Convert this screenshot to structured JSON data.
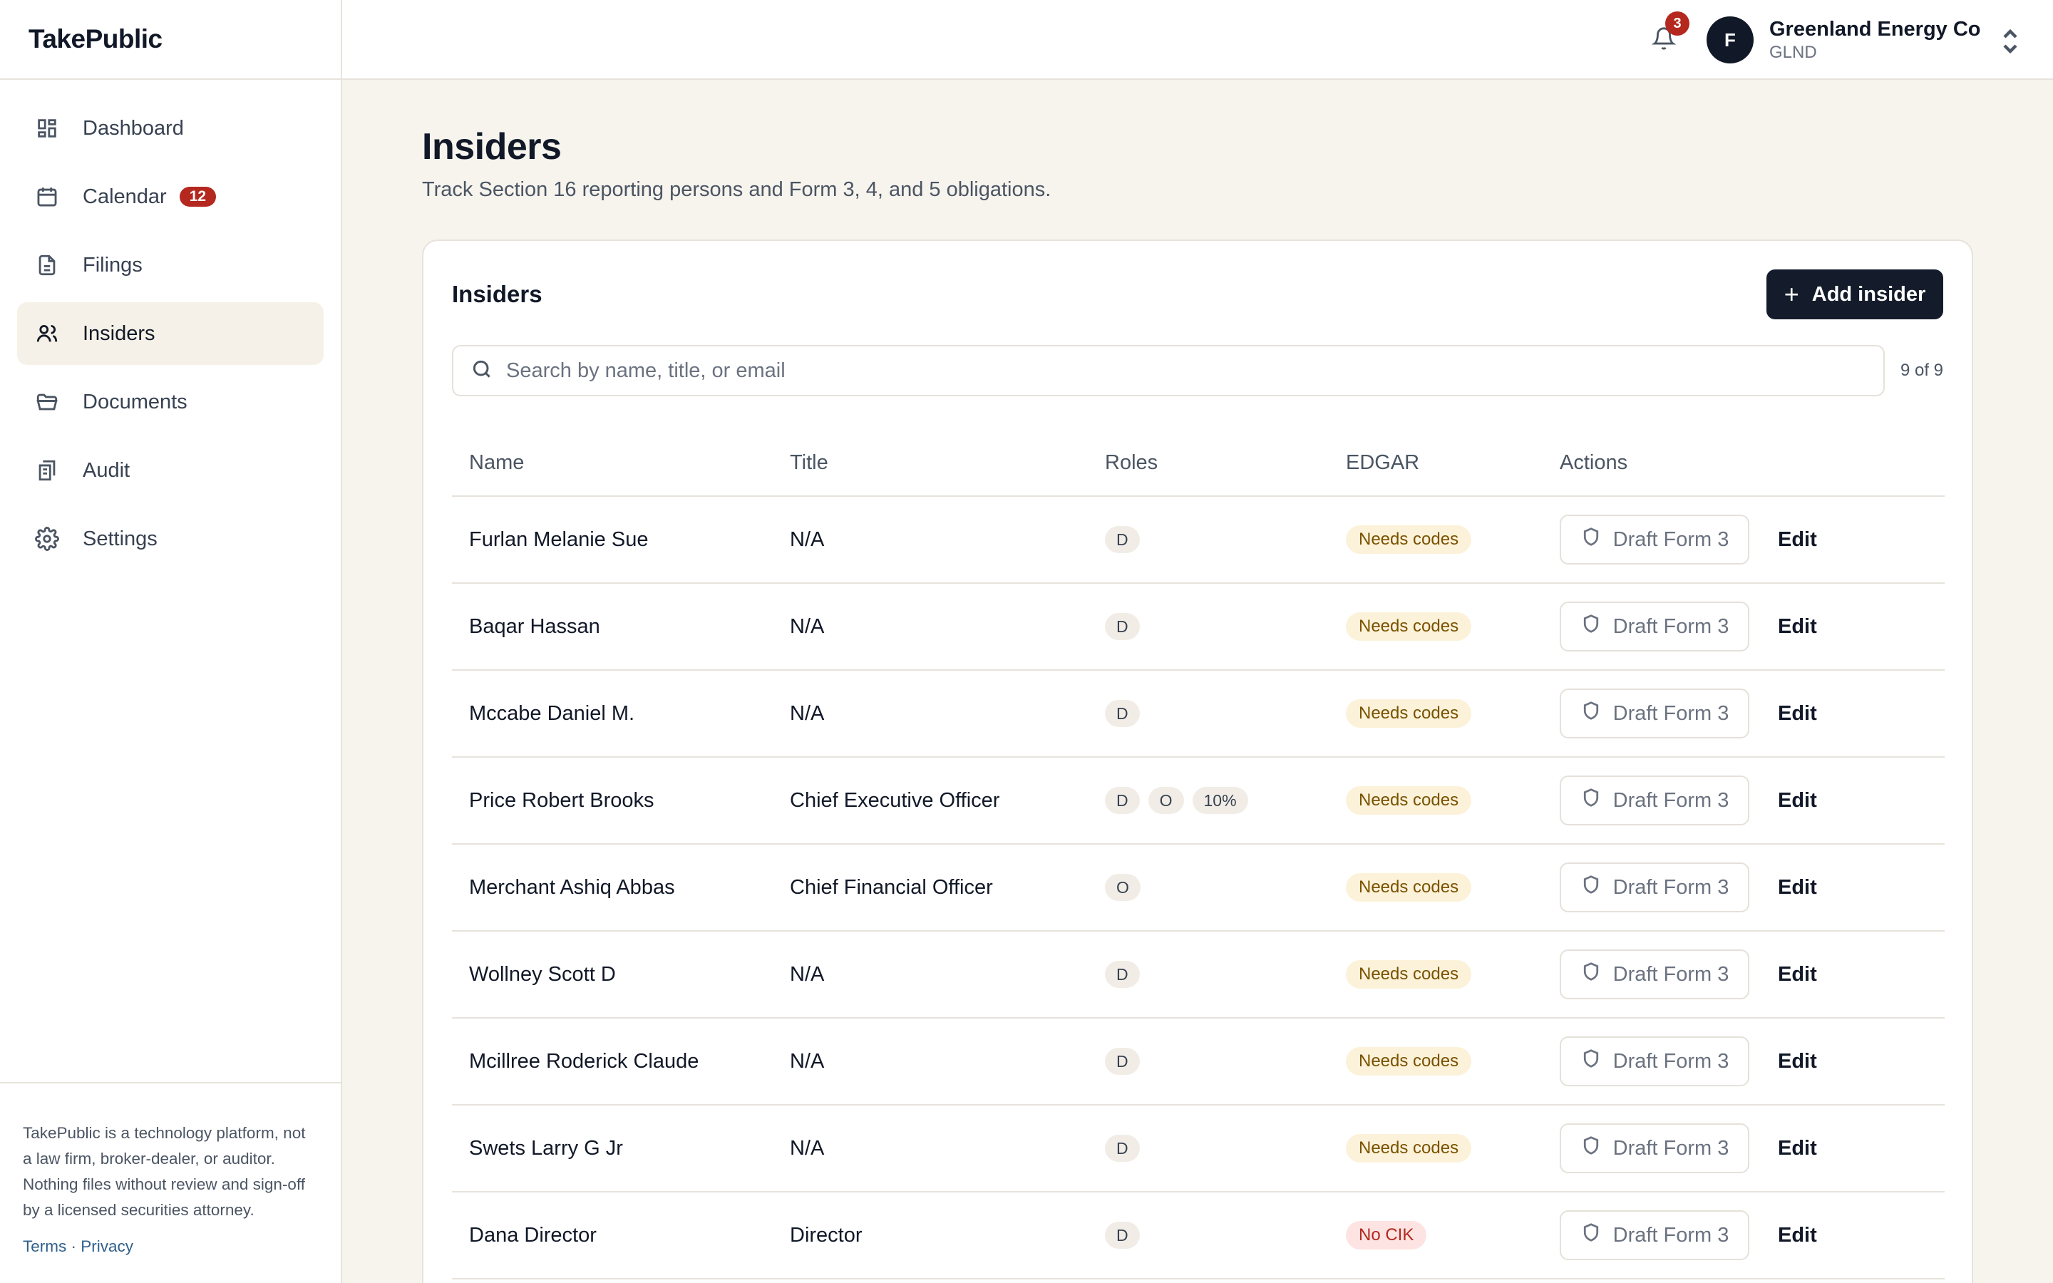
{
  "app": {
    "brand": "TakePublic"
  },
  "sidebar": {
    "items": [
      {
        "label": "Dashboard",
        "icon": "dashboard-icon",
        "active": false,
        "badge": ""
      },
      {
        "label": "Calendar",
        "icon": "calendar-icon",
        "active": false,
        "badge": "12"
      },
      {
        "label": "Filings",
        "icon": "file-icon",
        "active": false,
        "badge": ""
      },
      {
        "label": "Insiders",
        "icon": "users-icon",
        "active": true,
        "badge": ""
      },
      {
        "label": "Documents",
        "icon": "folder-icon",
        "active": false,
        "badge": ""
      },
      {
        "label": "Audit",
        "icon": "audit-icon",
        "active": false,
        "badge": ""
      },
      {
        "label": "Settings",
        "icon": "gear-icon",
        "active": false,
        "badge": ""
      }
    ],
    "disclaimer": "TakePublic is a technology platform, not a law firm, broker-dealer, or auditor. Nothing files without review and sign-off by a licensed securities attorney.",
    "terms_label": "Terms",
    "separator": "·",
    "privacy_label": "Privacy"
  },
  "topbar": {
    "notifications_count": "3",
    "company": {
      "avatar_initial": "F",
      "name": "Greenland Energy Co",
      "ticker": "GLND"
    }
  },
  "page": {
    "title": "Insiders",
    "subtitle": "Track Section 16 reporting persons and Form 3, 4, and 5 obligations."
  },
  "card": {
    "title": "Insiders",
    "add_button_label": "Add insider",
    "search_placeholder": "Search by name, title, or email",
    "search_value": "",
    "count_label": "9 of 9",
    "columns": [
      "Name",
      "Title",
      "Roles",
      "EDGAR",
      "Actions"
    ],
    "rows": [
      {
        "name": "Furlan Melanie Sue",
        "title": "N/A",
        "roles": [
          "D"
        ],
        "edgar": "Needs codes",
        "edgar_status": "warn",
        "action": "Draft Form 3",
        "edit": "Edit"
      },
      {
        "name": "Baqar Hassan",
        "title": "N/A",
        "roles": [
          "D"
        ],
        "edgar": "Needs codes",
        "edgar_status": "warn",
        "action": "Draft Form 3",
        "edit": "Edit"
      },
      {
        "name": "Mccabe Daniel M.",
        "title": "N/A",
        "roles": [
          "D"
        ],
        "edgar": "Needs codes",
        "edgar_status": "warn",
        "action": "Draft Form 3",
        "edit": "Edit"
      },
      {
        "name": "Price Robert Brooks",
        "title": "Chief Executive Officer",
        "roles": [
          "D",
          "O",
          "10%"
        ],
        "edgar": "Needs codes",
        "edgar_status": "warn",
        "action": "Draft Form 3",
        "edit": "Edit"
      },
      {
        "name": "Merchant Ashiq Abbas",
        "title": "Chief Financial Officer",
        "roles": [
          "O"
        ],
        "edgar": "Needs codes",
        "edgar_status": "warn",
        "action": "Draft Form 3",
        "edit": "Edit"
      },
      {
        "name": "Wollney Scott D",
        "title": "N/A",
        "roles": [
          "D"
        ],
        "edgar": "Needs codes",
        "edgar_status": "warn",
        "action": "Draft Form 3",
        "edit": "Edit"
      },
      {
        "name": "Mcillree Roderick Claude",
        "title": "N/A",
        "roles": [
          "D"
        ],
        "edgar": "Needs codes",
        "edgar_status": "warn",
        "action": "Draft Form 3",
        "edit": "Edit"
      },
      {
        "name": "Swets Larry G Jr",
        "title": "N/A",
        "roles": [
          "D"
        ],
        "edgar": "Needs codes",
        "edgar_status": "warn",
        "action": "Draft Form 3",
        "edit": "Edit"
      },
      {
        "name": "Dana Director",
        "title": "Director",
        "roles": [
          "D"
        ],
        "edgar": "No CIK",
        "edgar_status": "err",
        "action": "Draft Form 3",
        "edit": "Edit"
      }
    ]
  },
  "colors": {
    "accent": "#141c2b",
    "badge": "#b4281f",
    "warn_bg": "#fbf2d9",
    "err_bg": "#fde4e2",
    "background": "#f7f4ee"
  }
}
